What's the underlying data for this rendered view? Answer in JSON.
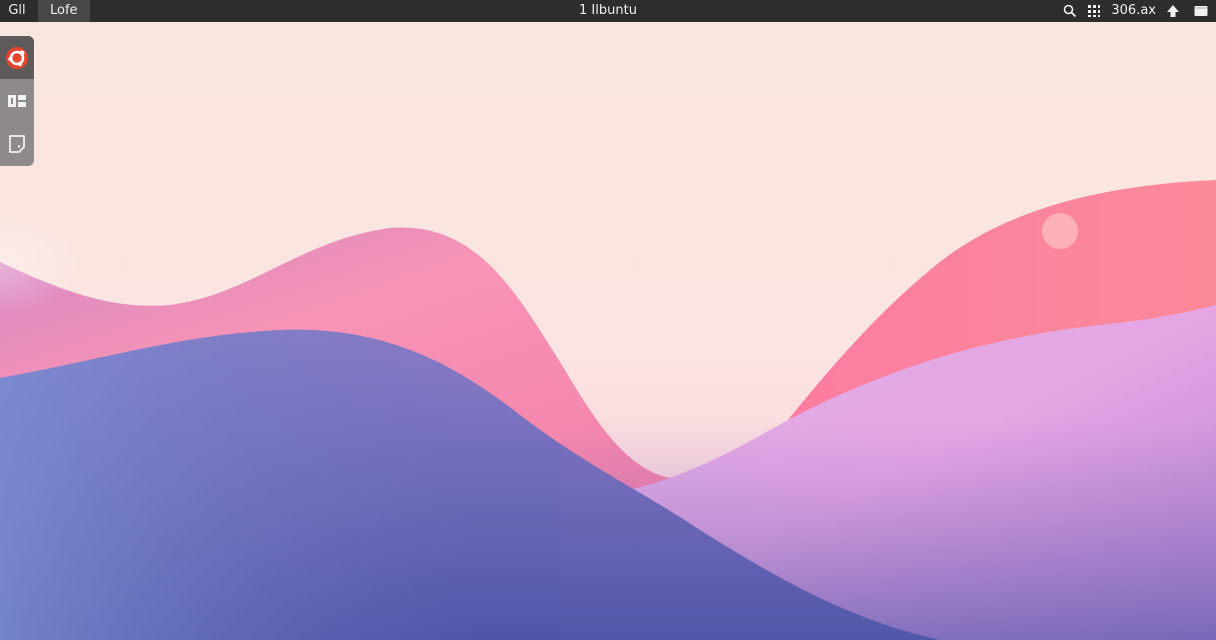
{
  "top_bar": {
    "activities_label": "Gll",
    "app_menu_label": "Lofe",
    "clock_label": "1 Ilbuntu",
    "battery_text": "306.ax",
    "icons": {
      "search": "search-icon",
      "grid": "apps-grid-icon",
      "network": "network-icon",
      "window": "window-icon"
    },
    "colors": {
      "bar": "#2d2d2d",
      "active_menu": "#474747"
    }
  },
  "dock": {
    "items": [
      {
        "name": "ubuntu-software-icon",
        "active": true
      },
      {
        "name": "workspaces-grid-icon",
        "active": false
      },
      {
        "name": "note-icon",
        "active": false
      }
    ],
    "colors": {
      "background": "#8f8a8a",
      "active": "#5e5a5a",
      "accent": "#e8442c"
    }
  },
  "wallpaper": {
    "style": "abstract pink and purple waves",
    "colors": {
      "sky": "#f9e7e1",
      "pink": "#f793ae",
      "purple": "#7f72c2",
      "lavender": "#dba2e3"
    }
  }
}
